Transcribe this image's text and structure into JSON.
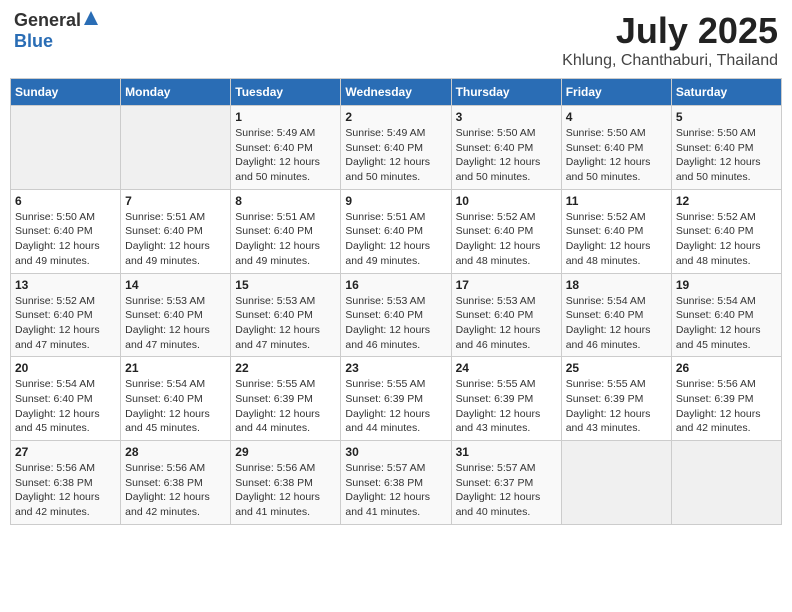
{
  "header": {
    "logo_general": "General",
    "logo_blue": "Blue",
    "month": "July 2025",
    "location": "Khlung, Chanthaburi, Thailand"
  },
  "weekdays": [
    "Sunday",
    "Monday",
    "Tuesday",
    "Wednesday",
    "Thursday",
    "Friday",
    "Saturday"
  ],
  "weeks": [
    [
      {
        "day": "",
        "empty": true
      },
      {
        "day": "",
        "empty": true
      },
      {
        "day": "1",
        "sunrise": "Sunrise: 5:49 AM",
        "sunset": "Sunset: 6:40 PM",
        "daylight": "Daylight: 12 hours and 50 minutes."
      },
      {
        "day": "2",
        "sunrise": "Sunrise: 5:49 AM",
        "sunset": "Sunset: 6:40 PM",
        "daylight": "Daylight: 12 hours and 50 minutes."
      },
      {
        "day": "3",
        "sunrise": "Sunrise: 5:50 AM",
        "sunset": "Sunset: 6:40 PM",
        "daylight": "Daylight: 12 hours and 50 minutes."
      },
      {
        "day": "4",
        "sunrise": "Sunrise: 5:50 AM",
        "sunset": "Sunset: 6:40 PM",
        "daylight": "Daylight: 12 hours and 50 minutes."
      },
      {
        "day": "5",
        "sunrise": "Sunrise: 5:50 AM",
        "sunset": "Sunset: 6:40 PM",
        "daylight": "Daylight: 12 hours and 50 minutes."
      }
    ],
    [
      {
        "day": "6",
        "sunrise": "Sunrise: 5:50 AM",
        "sunset": "Sunset: 6:40 PM",
        "daylight": "Daylight: 12 hours and 49 minutes."
      },
      {
        "day": "7",
        "sunrise": "Sunrise: 5:51 AM",
        "sunset": "Sunset: 6:40 PM",
        "daylight": "Daylight: 12 hours and 49 minutes."
      },
      {
        "day": "8",
        "sunrise": "Sunrise: 5:51 AM",
        "sunset": "Sunset: 6:40 PM",
        "daylight": "Daylight: 12 hours and 49 minutes."
      },
      {
        "day": "9",
        "sunrise": "Sunrise: 5:51 AM",
        "sunset": "Sunset: 6:40 PM",
        "daylight": "Daylight: 12 hours and 49 minutes."
      },
      {
        "day": "10",
        "sunrise": "Sunrise: 5:52 AM",
        "sunset": "Sunset: 6:40 PM",
        "daylight": "Daylight: 12 hours and 48 minutes."
      },
      {
        "day": "11",
        "sunrise": "Sunrise: 5:52 AM",
        "sunset": "Sunset: 6:40 PM",
        "daylight": "Daylight: 12 hours and 48 minutes."
      },
      {
        "day": "12",
        "sunrise": "Sunrise: 5:52 AM",
        "sunset": "Sunset: 6:40 PM",
        "daylight": "Daylight: 12 hours and 48 minutes."
      }
    ],
    [
      {
        "day": "13",
        "sunrise": "Sunrise: 5:52 AM",
        "sunset": "Sunset: 6:40 PM",
        "daylight": "Daylight: 12 hours and 47 minutes."
      },
      {
        "day": "14",
        "sunrise": "Sunrise: 5:53 AM",
        "sunset": "Sunset: 6:40 PM",
        "daylight": "Daylight: 12 hours and 47 minutes."
      },
      {
        "day": "15",
        "sunrise": "Sunrise: 5:53 AM",
        "sunset": "Sunset: 6:40 PM",
        "daylight": "Daylight: 12 hours and 47 minutes."
      },
      {
        "day": "16",
        "sunrise": "Sunrise: 5:53 AM",
        "sunset": "Sunset: 6:40 PM",
        "daylight": "Daylight: 12 hours and 46 minutes."
      },
      {
        "day": "17",
        "sunrise": "Sunrise: 5:53 AM",
        "sunset": "Sunset: 6:40 PM",
        "daylight": "Daylight: 12 hours and 46 minutes."
      },
      {
        "day": "18",
        "sunrise": "Sunrise: 5:54 AM",
        "sunset": "Sunset: 6:40 PM",
        "daylight": "Daylight: 12 hours and 46 minutes."
      },
      {
        "day": "19",
        "sunrise": "Sunrise: 5:54 AM",
        "sunset": "Sunset: 6:40 PM",
        "daylight": "Daylight: 12 hours and 45 minutes."
      }
    ],
    [
      {
        "day": "20",
        "sunrise": "Sunrise: 5:54 AM",
        "sunset": "Sunset: 6:40 PM",
        "daylight": "Daylight: 12 hours and 45 minutes."
      },
      {
        "day": "21",
        "sunrise": "Sunrise: 5:54 AM",
        "sunset": "Sunset: 6:40 PM",
        "daylight": "Daylight: 12 hours and 45 minutes."
      },
      {
        "day": "22",
        "sunrise": "Sunrise: 5:55 AM",
        "sunset": "Sunset: 6:39 PM",
        "daylight": "Daylight: 12 hours and 44 minutes."
      },
      {
        "day": "23",
        "sunrise": "Sunrise: 5:55 AM",
        "sunset": "Sunset: 6:39 PM",
        "daylight": "Daylight: 12 hours and 44 minutes."
      },
      {
        "day": "24",
        "sunrise": "Sunrise: 5:55 AM",
        "sunset": "Sunset: 6:39 PM",
        "daylight": "Daylight: 12 hours and 43 minutes."
      },
      {
        "day": "25",
        "sunrise": "Sunrise: 5:55 AM",
        "sunset": "Sunset: 6:39 PM",
        "daylight": "Daylight: 12 hours and 43 minutes."
      },
      {
        "day": "26",
        "sunrise": "Sunrise: 5:56 AM",
        "sunset": "Sunset: 6:39 PM",
        "daylight": "Daylight: 12 hours and 42 minutes."
      }
    ],
    [
      {
        "day": "27",
        "sunrise": "Sunrise: 5:56 AM",
        "sunset": "Sunset: 6:38 PM",
        "daylight": "Daylight: 12 hours and 42 minutes."
      },
      {
        "day": "28",
        "sunrise": "Sunrise: 5:56 AM",
        "sunset": "Sunset: 6:38 PM",
        "daylight": "Daylight: 12 hours and 42 minutes."
      },
      {
        "day": "29",
        "sunrise": "Sunrise: 5:56 AM",
        "sunset": "Sunset: 6:38 PM",
        "daylight": "Daylight: 12 hours and 41 minutes."
      },
      {
        "day": "30",
        "sunrise": "Sunrise: 5:57 AM",
        "sunset": "Sunset: 6:38 PM",
        "daylight": "Daylight: 12 hours and 41 minutes."
      },
      {
        "day": "31",
        "sunrise": "Sunrise: 5:57 AM",
        "sunset": "Sunset: 6:37 PM",
        "daylight": "Daylight: 12 hours and 40 minutes."
      },
      {
        "day": "",
        "empty": true
      },
      {
        "day": "",
        "empty": true
      }
    ]
  ]
}
